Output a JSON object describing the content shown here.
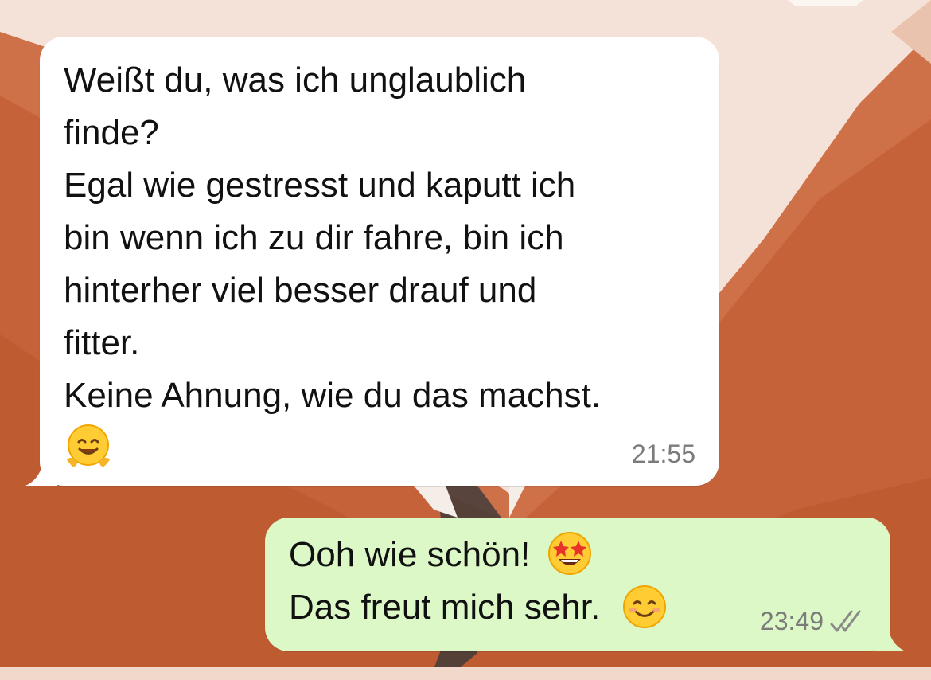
{
  "messages": [
    {
      "direction": "incoming",
      "lines": [
        "Weißt du, was ich unglaublich",
        "finde?",
        "Egal wie gestresst und kaputt ich",
        "bin wenn ich zu dir fahre, bin ich",
        "hinterher viel besser drauf und",
        "fitter.",
        "Keine Ahnung, wie du das machst."
      ],
      "emoji": "hugging-face",
      "time": "21:55"
    },
    {
      "direction": "outgoing",
      "lines": [
        "Ooh wie schön!",
        "Das freut mich sehr."
      ],
      "emojis": [
        "star-struck",
        "smiling-face"
      ],
      "time": "23:49",
      "status": "read"
    }
  ],
  "colors": {
    "incoming_bubble": "#ffffff",
    "outgoing_bubble": "#dcf8c6",
    "wallpaper_accent": "#c8643a",
    "timestamp": "#7b7b7b"
  }
}
